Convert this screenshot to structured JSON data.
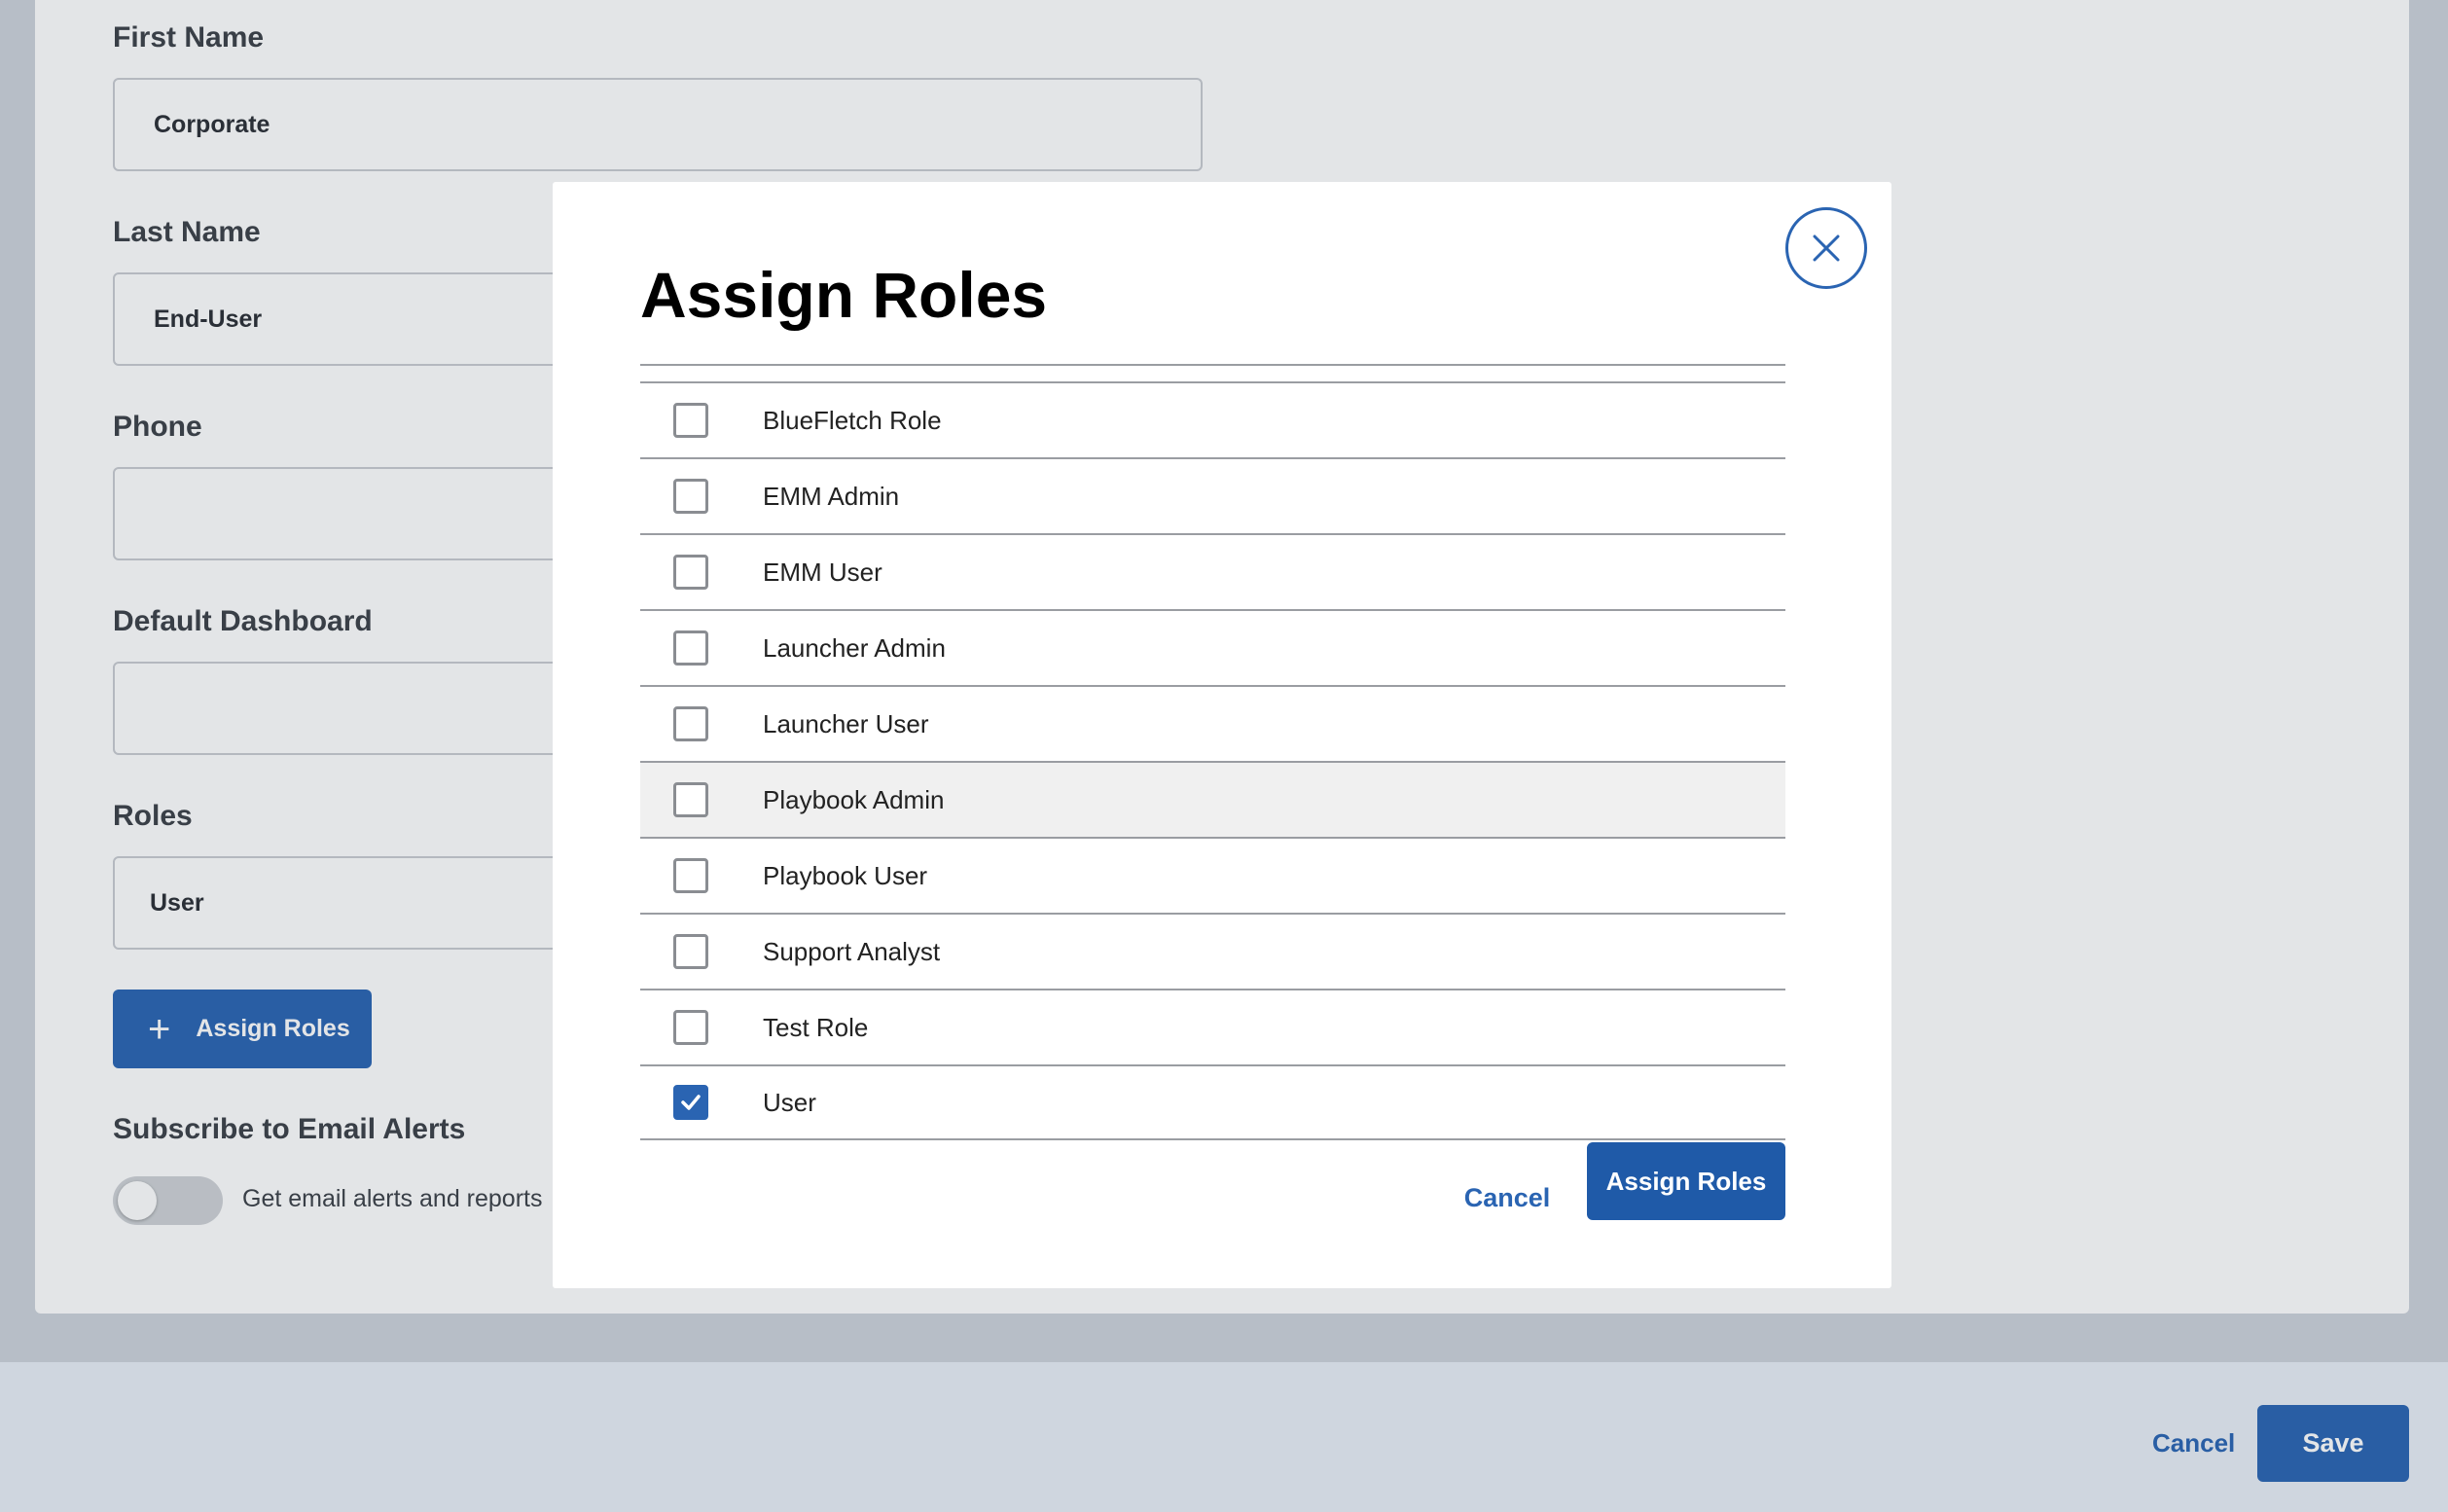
{
  "form": {
    "first_name_label": "First Name",
    "first_name_value": "Corporate",
    "last_name_label": "Last Name",
    "last_name_value": "End-User",
    "phone_label": "Phone",
    "phone_value": "",
    "dashboard_label": "Default Dashboard",
    "dashboard_value": "",
    "roles_label": "Roles",
    "roles_value": "User",
    "assign_roles_button": "Assign Roles",
    "email_alerts_label": "Subscribe to Email Alerts",
    "email_alerts_toggle_text": "Get email alerts and reports",
    "email_alerts_enabled": false
  },
  "footer": {
    "cancel_label": "Cancel",
    "save_label": "Save"
  },
  "modal": {
    "title": "Assign Roles",
    "close_icon": "close-icon",
    "roles": [
      {
        "label": "BlueFletch Role",
        "checked": false
      },
      {
        "label": "EMM Admin",
        "checked": false
      },
      {
        "label": "EMM User",
        "checked": false
      },
      {
        "label": "Launcher Admin",
        "checked": false
      },
      {
        "label": "Launcher User",
        "checked": false
      },
      {
        "label": "Playbook Admin",
        "checked": false
      },
      {
        "label": "Playbook User",
        "checked": false
      },
      {
        "label": "Support Analyst",
        "checked": false
      },
      {
        "label": "Test Role",
        "checked": false
      },
      {
        "label": "User",
        "checked": true
      }
    ],
    "cancel_label": "Cancel",
    "assign_label": "Assign Roles"
  },
  "colors": {
    "accent": "#2a64b2",
    "hover_row": "#f0f0f0"
  }
}
